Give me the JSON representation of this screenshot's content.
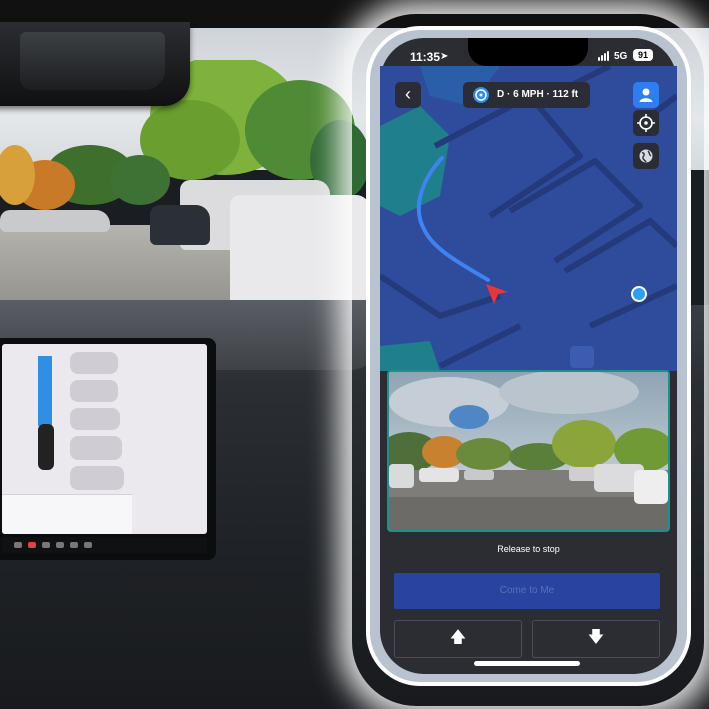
{
  "status_bar": {
    "time": "11:35",
    "network": "5G",
    "battery": "91"
  },
  "header": {
    "summon_status": "D · 6 MPH · 112 ft"
  },
  "camera": {
    "hint": "Release to stop"
  },
  "controls": {
    "come_to_me_label": "Come to Me",
    "forward_glyph": "🡅",
    "reverse_glyph": "🡇"
  },
  "icons": {
    "back": "chevron-left-icon",
    "steering": "steering-wheel-icon",
    "person": "person-icon",
    "recenter": "crosshair-icon",
    "map_style": "globe-icon"
  },
  "colors": {
    "map_bg": "#2f4c9c",
    "path": "#3f83f2",
    "car_arrow": "#e8353a",
    "phone_dot": "#2aa0f0",
    "button_primary": "#2943a0"
  }
}
